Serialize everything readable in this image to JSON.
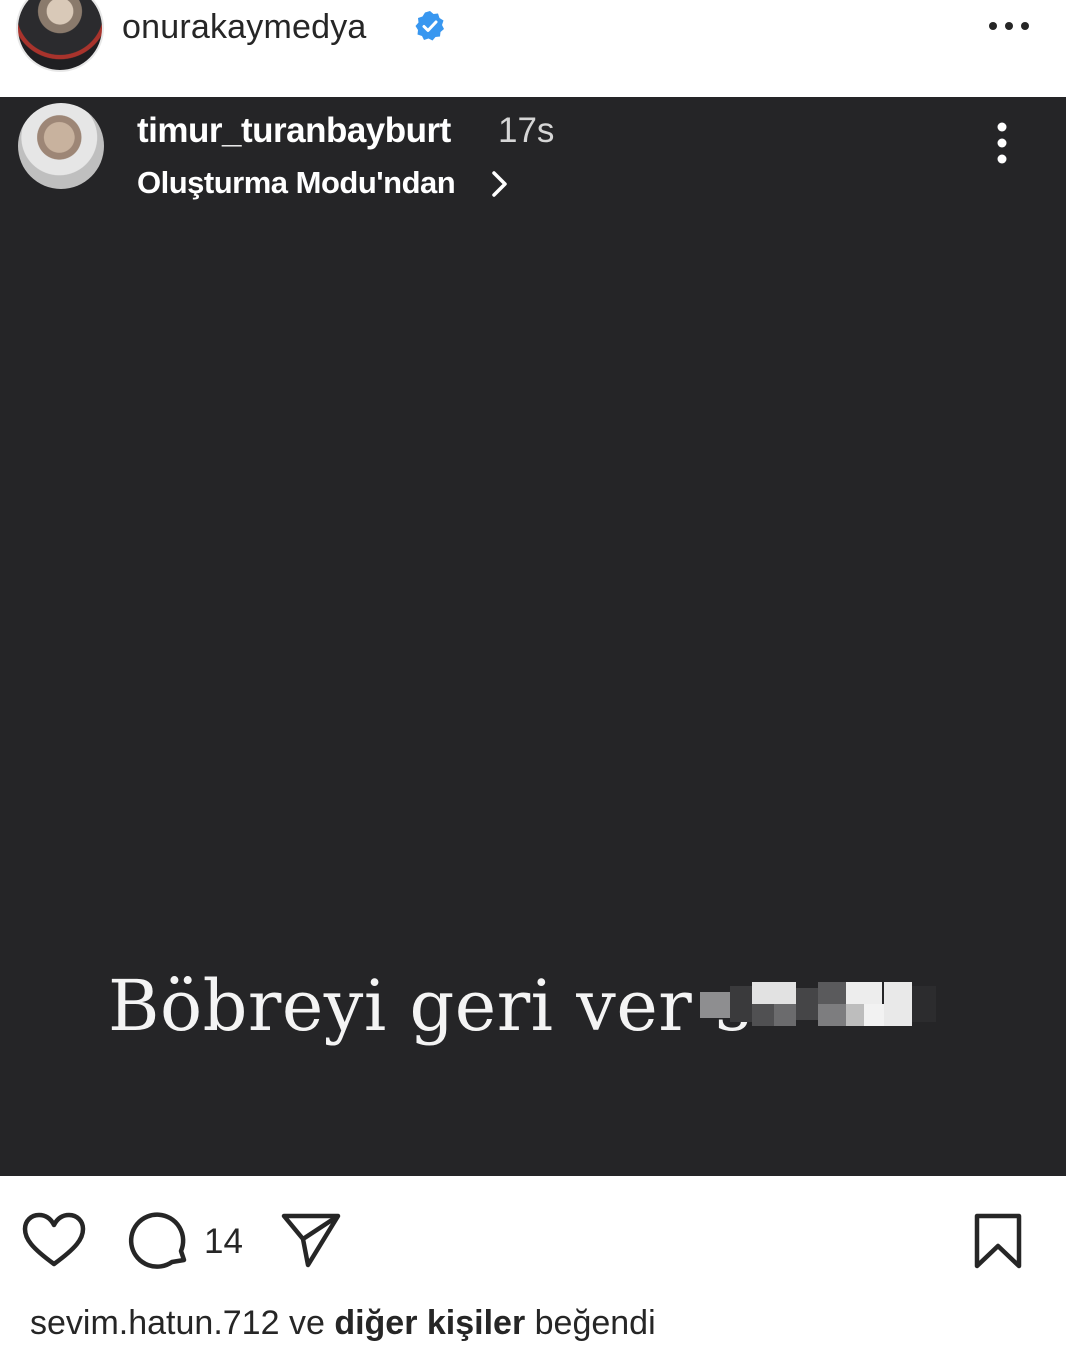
{
  "post": {
    "author": "onurakaymedya",
    "verified": true
  },
  "story": {
    "username": "timur_turanbayburt",
    "time": "17s",
    "source": "Oluşturma Modu'ndan",
    "caption": "Böbreyi geri ver s",
    "background_color": "#252527"
  },
  "actions": {
    "comment_count": "14",
    "icons": [
      "heart-icon",
      "comment-icon",
      "share-icon",
      "bookmark-icon"
    ]
  },
  "likes": {
    "user": "sevim.hatun.712",
    "connector": " ve ",
    "others": "diğer kişiler",
    "suffix": " beğendi"
  },
  "colors": {
    "verified_blue": "#3897f0",
    "text_dark": "#262626"
  }
}
